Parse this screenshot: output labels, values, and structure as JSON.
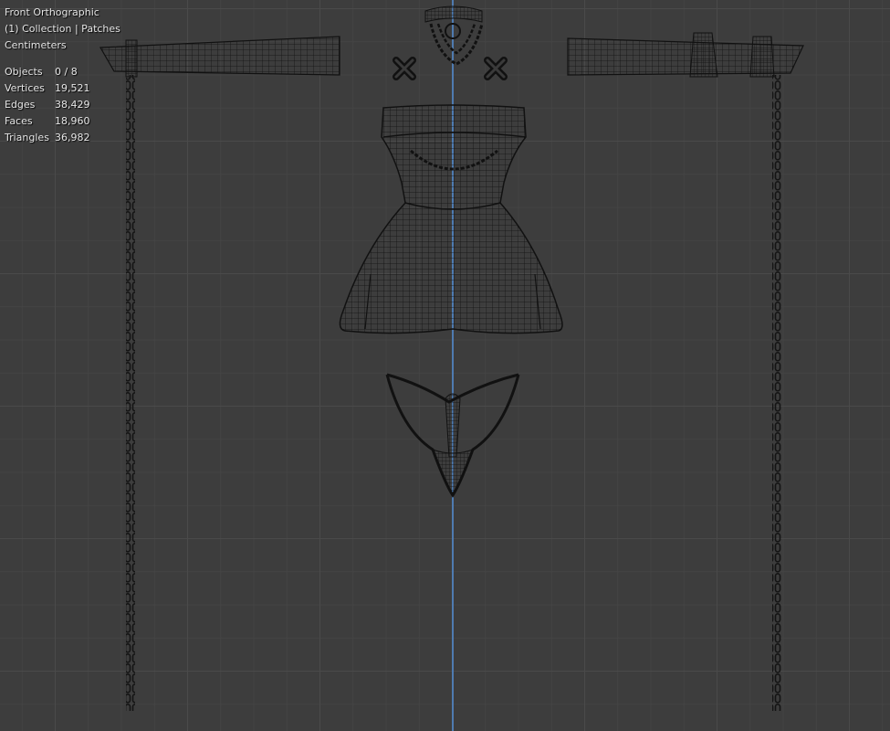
{
  "viewport": {
    "view_name": "Front Orthographic",
    "collection": "(1) Collection | Patches",
    "units": "Centimeters"
  },
  "stats": [
    {
      "label": "Objects",
      "value": "0 / 8"
    },
    {
      "label": "Vertices",
      "value": "19,521"
    },
    {
      "label": "Edges",
      "value": "38,429"
    },
    {
      "label": "Faces",
      "value": "18,960"
    },
    {
      "label": "Triangles",
      "value": "36,982"
    }
  ],
  "colors": {
    "background": "#3d3d3d",
    "grid": "#4a4a4a",
    "axis_z": "#4f7bb0",
    "wire": "#0f0f0f"
  }
}
